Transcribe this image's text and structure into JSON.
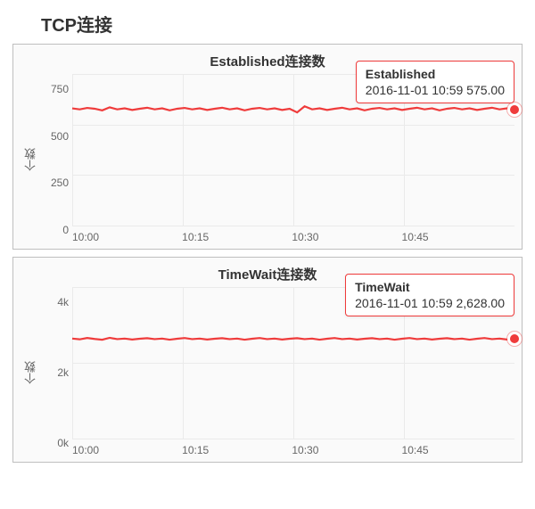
{
  "page_title": "TCP连接",
  "ylabel": "个数",
  "accent": "#ef3b3b",
  "charts": [
    {
      "title": "Established连接数",
      "yticks": [
        "750",
        "500",
        "250",
        "0"
      ],
      "xticks": [
        "10:00",
        "10:15",
        "10:30",
        "10:45"
      ],
      "tooltip": {
        "name": "Established",
        "line2": "2016-11-01 10:59 575.00"
      }
    },
    {
      "title": "TimeWait连接数",
      "yticks": [
        "4k",
        "2k",
        "0k"
      ],
      "xticks": [
        "10:00",
        "10:15",
        "10:30",
        "10:45"
      ],
      "tooltip": {
        "name": "TimeWait",
        "line2": "2016-11-01 10:59 2,628.00"
      }
    }
  ],
  "chart_data": [
    {
      "type": "line",
      "title": "Established连接数",
      "xlabel": "",
      "ylabel": "个数",
      "ylim": [
        0,
        750
      ],
      "x_start": "2016-11-01 10:00",
      "x_end": "2016-11-01 10:59",
      "x_tick_labels": [
        "10:00",
        "10:15",
        "10:30",
        "10:45"
      ],
      "series": [
        {
          "name": "Established",
          "values": [
            580,
            575,
            582,
            578,
            570,
            585,
            575,
            580,
            572,
            578,
            583,
            575,
            580,
            570,
            578,
            582,
            575,
            580,
            572,
            578,
            583,
            575,
            580,
            570,
            578,
            582,
            575,
            580,
            572,
            578,
            560,
            590,
            575,
            580,
            572,
            578,
            583,
            575,
            580,
            570,
            578,
            582,
            575,
            580,
            572,
            578,
            583,
            575,
            580,
            570,
            578,
            582,
            575,
            580,
            572,
            578,
            583,
            575,
            580,
            575
          ]
        }
      ],
      "tooltip_point": {
        "x_label": "2016-11-01 10:59",
        "value": 575.0
      }
    },
    {
      "type": "line",
      "title": "TimeWait连接数",
      "xlabel": "",
      "ylabel": "个数",
      "ylim": [
        0,
        4000
      ],
      "x_start": "2016-11-01 10:00",
      "x_end": "2016-11-01 10:59",
      "x_tick_labels": [
        "10:00",
        "10:15",
        "10:30",
        "10:45"
      ],
      "series": [
        {
          "name": "TimeWait",
          "values": [
            2640,
            2620,
            2655,
            2630,
            2610,
            2660,
            2625,
            2640,
            2615,
            2635,
            2650,
            2625,
            2640,
            2610,
            2635,
            2655,
            2625,
            2640,
            2615,
            2635,
            2650,
            2625,
            2640,
            2610,
            2635,
            2655,
            2625,
            2640,
            2615,
            2635,
            2650,
            2625,
            2640,
            2610,
            2635,
            2655,
            2625,
            2640,
            2615,
            2635,
            2650,
            2625,
            2640,
            2610,
            2635,
            2655,
            2625,
            2640,
            2615,
            2635,
            2650,
            2625,
            2640,
            2610,
            2635,
            2655,
            2625,
            2640,
            2615,
            2628
          ]
        }
      ],
      "tooltip_point": {
        "x_label": "2016-11-01 10:59",
        "value": 2628.0
      }
    }
  ]
}
